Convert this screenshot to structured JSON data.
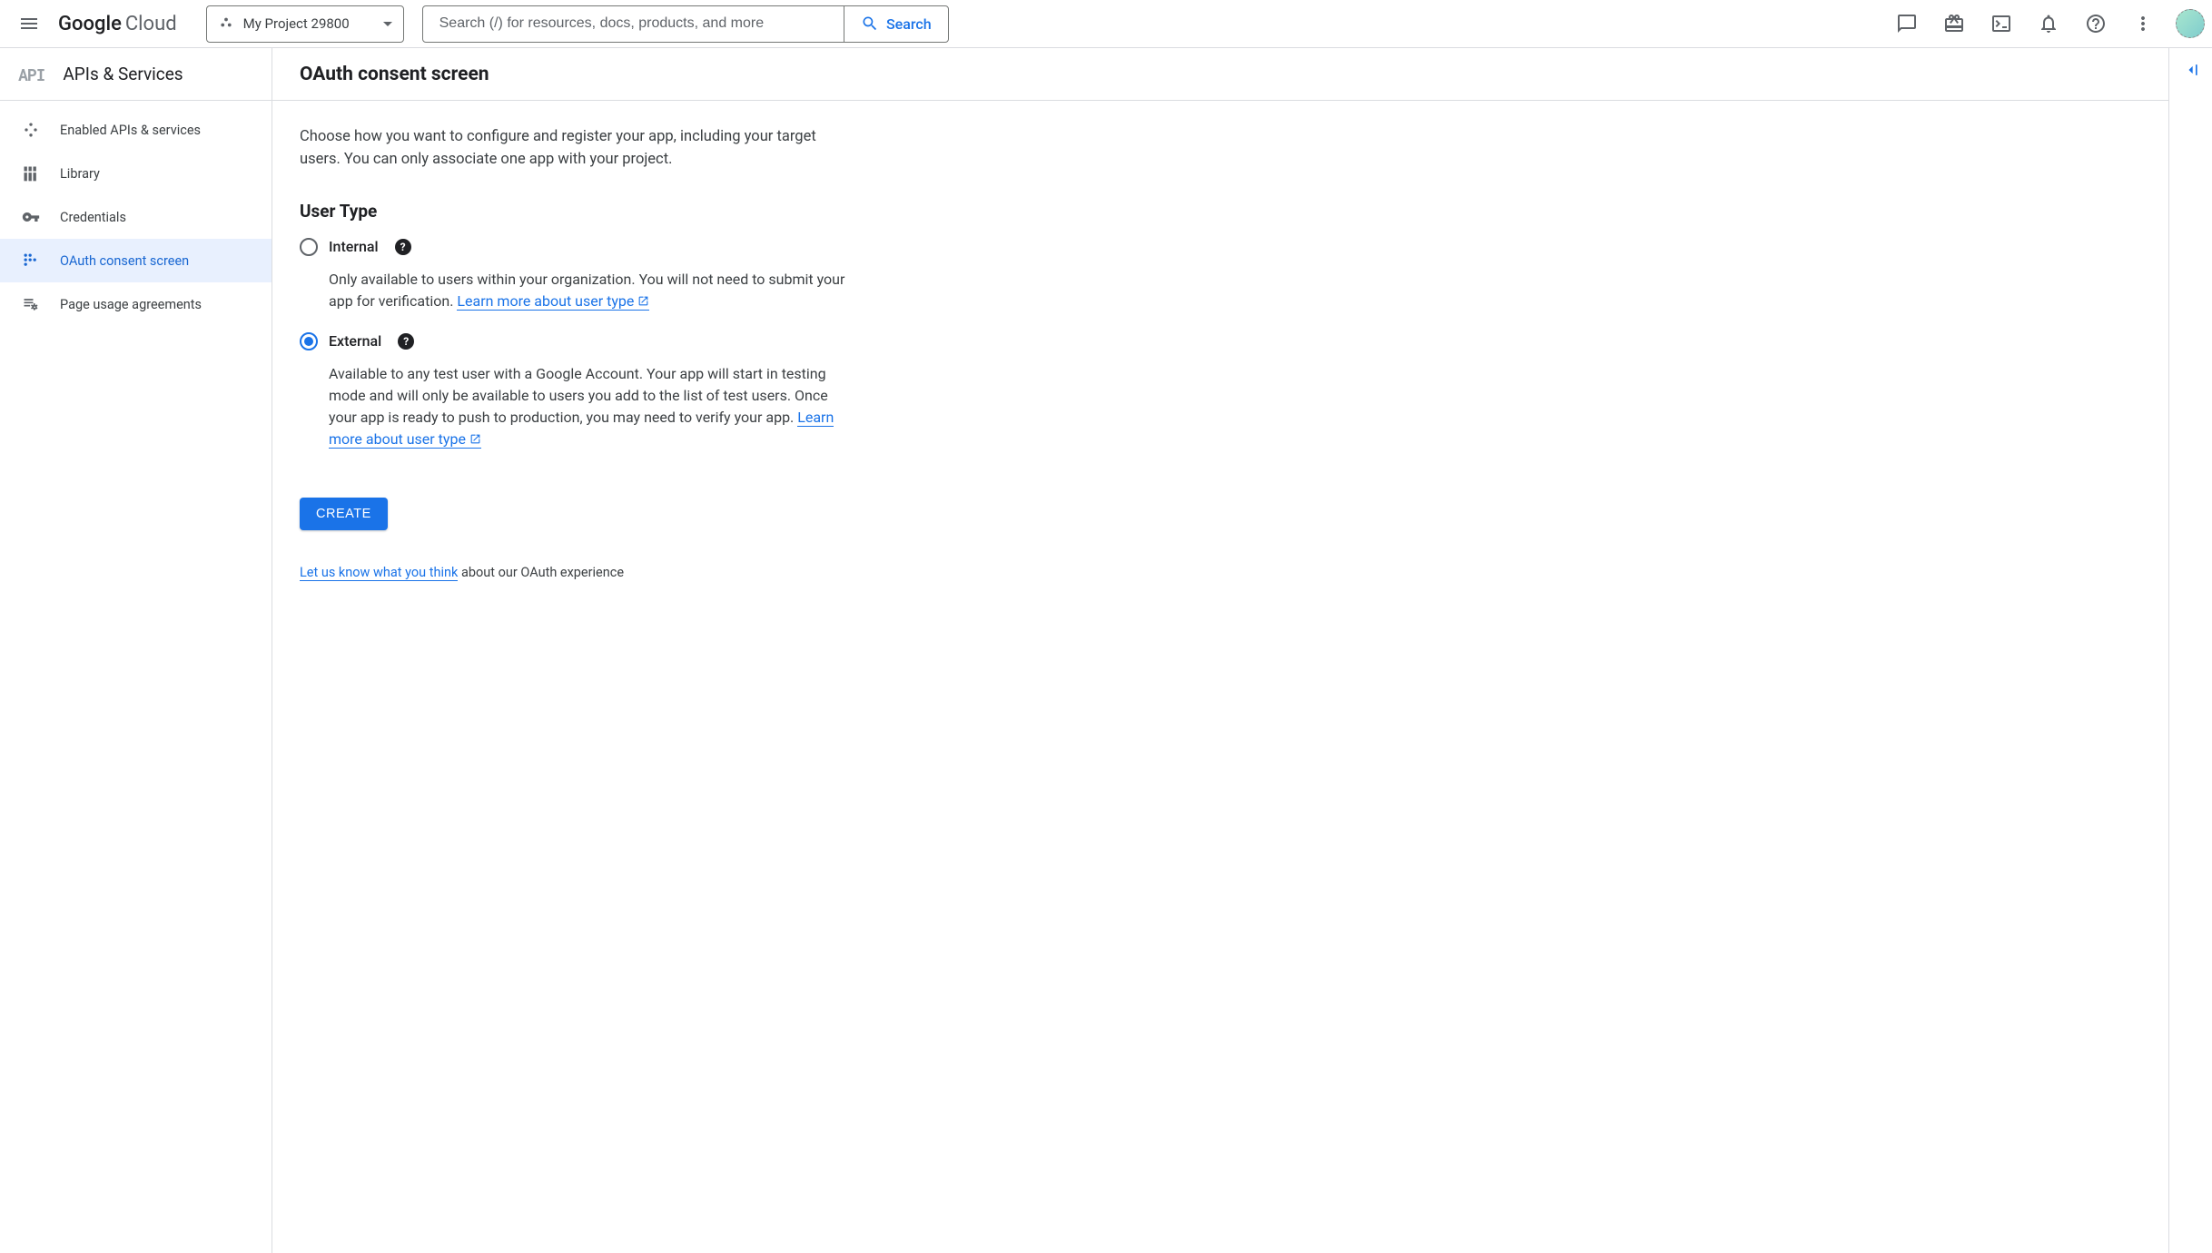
{
  "header": {
    "logo_cloud": "Cloud",
    "project_name": "My Project 29800",
    "search_placeholder": "Search (/) for resources, docs, products, and more",
    "search_button": "Search"
  },
  "sidebar": {
    "api_badge": "API",
    "title": "APIs & Services",
    "items": [
      {
        "label": "Enabled APIs & services"
      },
      {
        "label": "Library"
      },
      {
        "label": "Credentials"
      },
      {
        "label": "OAuth consent screen"
      },
      {
        "label": "Page usage agreements"
      }
    ]
  },
  "main": {
    "page_title": "OAuth consent screen",
    "intro": "Choose how you want to configure and register your app, including your target users. You can only associate one app with your project.",
    "section_heading": "User Type",
    "options": {
      "internal": {
        "label": "Internal",
        "desc_pre": "Only available to users within your organization. You will not need to submit your app for verification. ",
        "link": "Learn more about user type"
      },
      "external": {
        "label": "External",
        "desc_pre": "Available to any test user with a Google Account. Your app will start in testing mode and will only be available to users you add to the list of test users. Once your app is ready to push to production, you may need to verify your app. ",
        "link": "Learn more about user type"
      }
    },
    "create_button": "CREATE",
    "feedback_link": "Let us know what you think",
    "feedback_suffix": " about our OAuth experience"
  }
}
